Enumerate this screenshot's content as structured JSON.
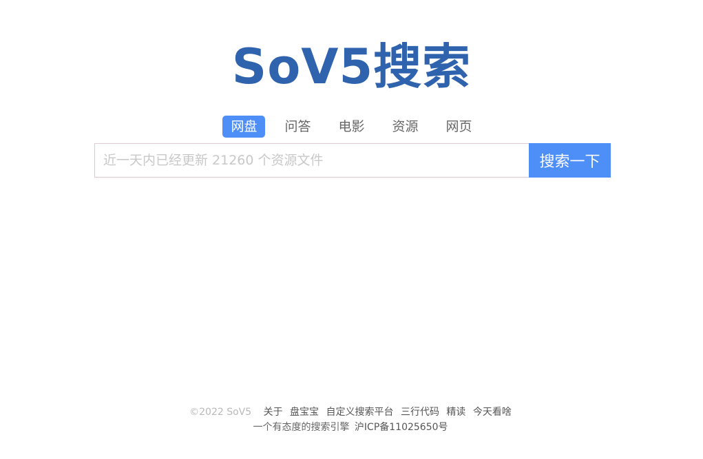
{
  "logo": {
    "text": "SoV5搜索"
  },
  "tabs": [
    {
      "label": "网盘",
      "active": true
    },
    {
      "label": "问答",
      "active": false
    },
    {
      "label": "电影",
      "active": false
    },
    {
      "label": "资源",
      "active": false
    },
    {
      "label": "网页",
      "active": false
    }
  ],
  "search": {
    "placeholder": "近一天内已经更新 21260 个资源文件",
    "value": "",
    "button_label": "搜索一下"
  },
  "footer": {
    "copyright": "©2022 SoV5",
    "links": [
      "关于",
      "盘宝宝",
      "自定义搜索平台",
      "三行代码",
      "精读",
      "今天看啥"
    ],
    "slogan": "一个有态度的搜索引擎",
    "icp": "沪ICP备11025650号"
  },
  "colors": {
    "brand": "#3063ad",
    "accent": "#4e8ef7"
  }
}
